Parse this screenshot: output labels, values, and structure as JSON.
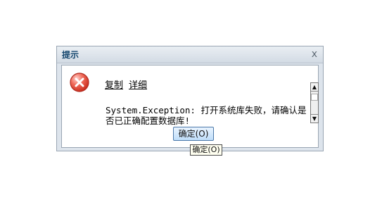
{
  "dialog": {
    "title": "提示",
    "close_symbol": "x",
    "links": {
      "copy": "复制",
      "detail": "详细"
    },
    "message": "System.Exception: 打开系统库失败，请确认是否已正确配置数据库!",
    "ok_label": "确定(O)",
    "tooltip": "确定(O)"
  },
  "icons": {
    "error": "error-icon",
    "close": "close-icon"
  },
  "colors": {
    "title": "#14466e",
    "error_red": "#e14b3b",
    "button_border": "#4a77a8"
  }
}
